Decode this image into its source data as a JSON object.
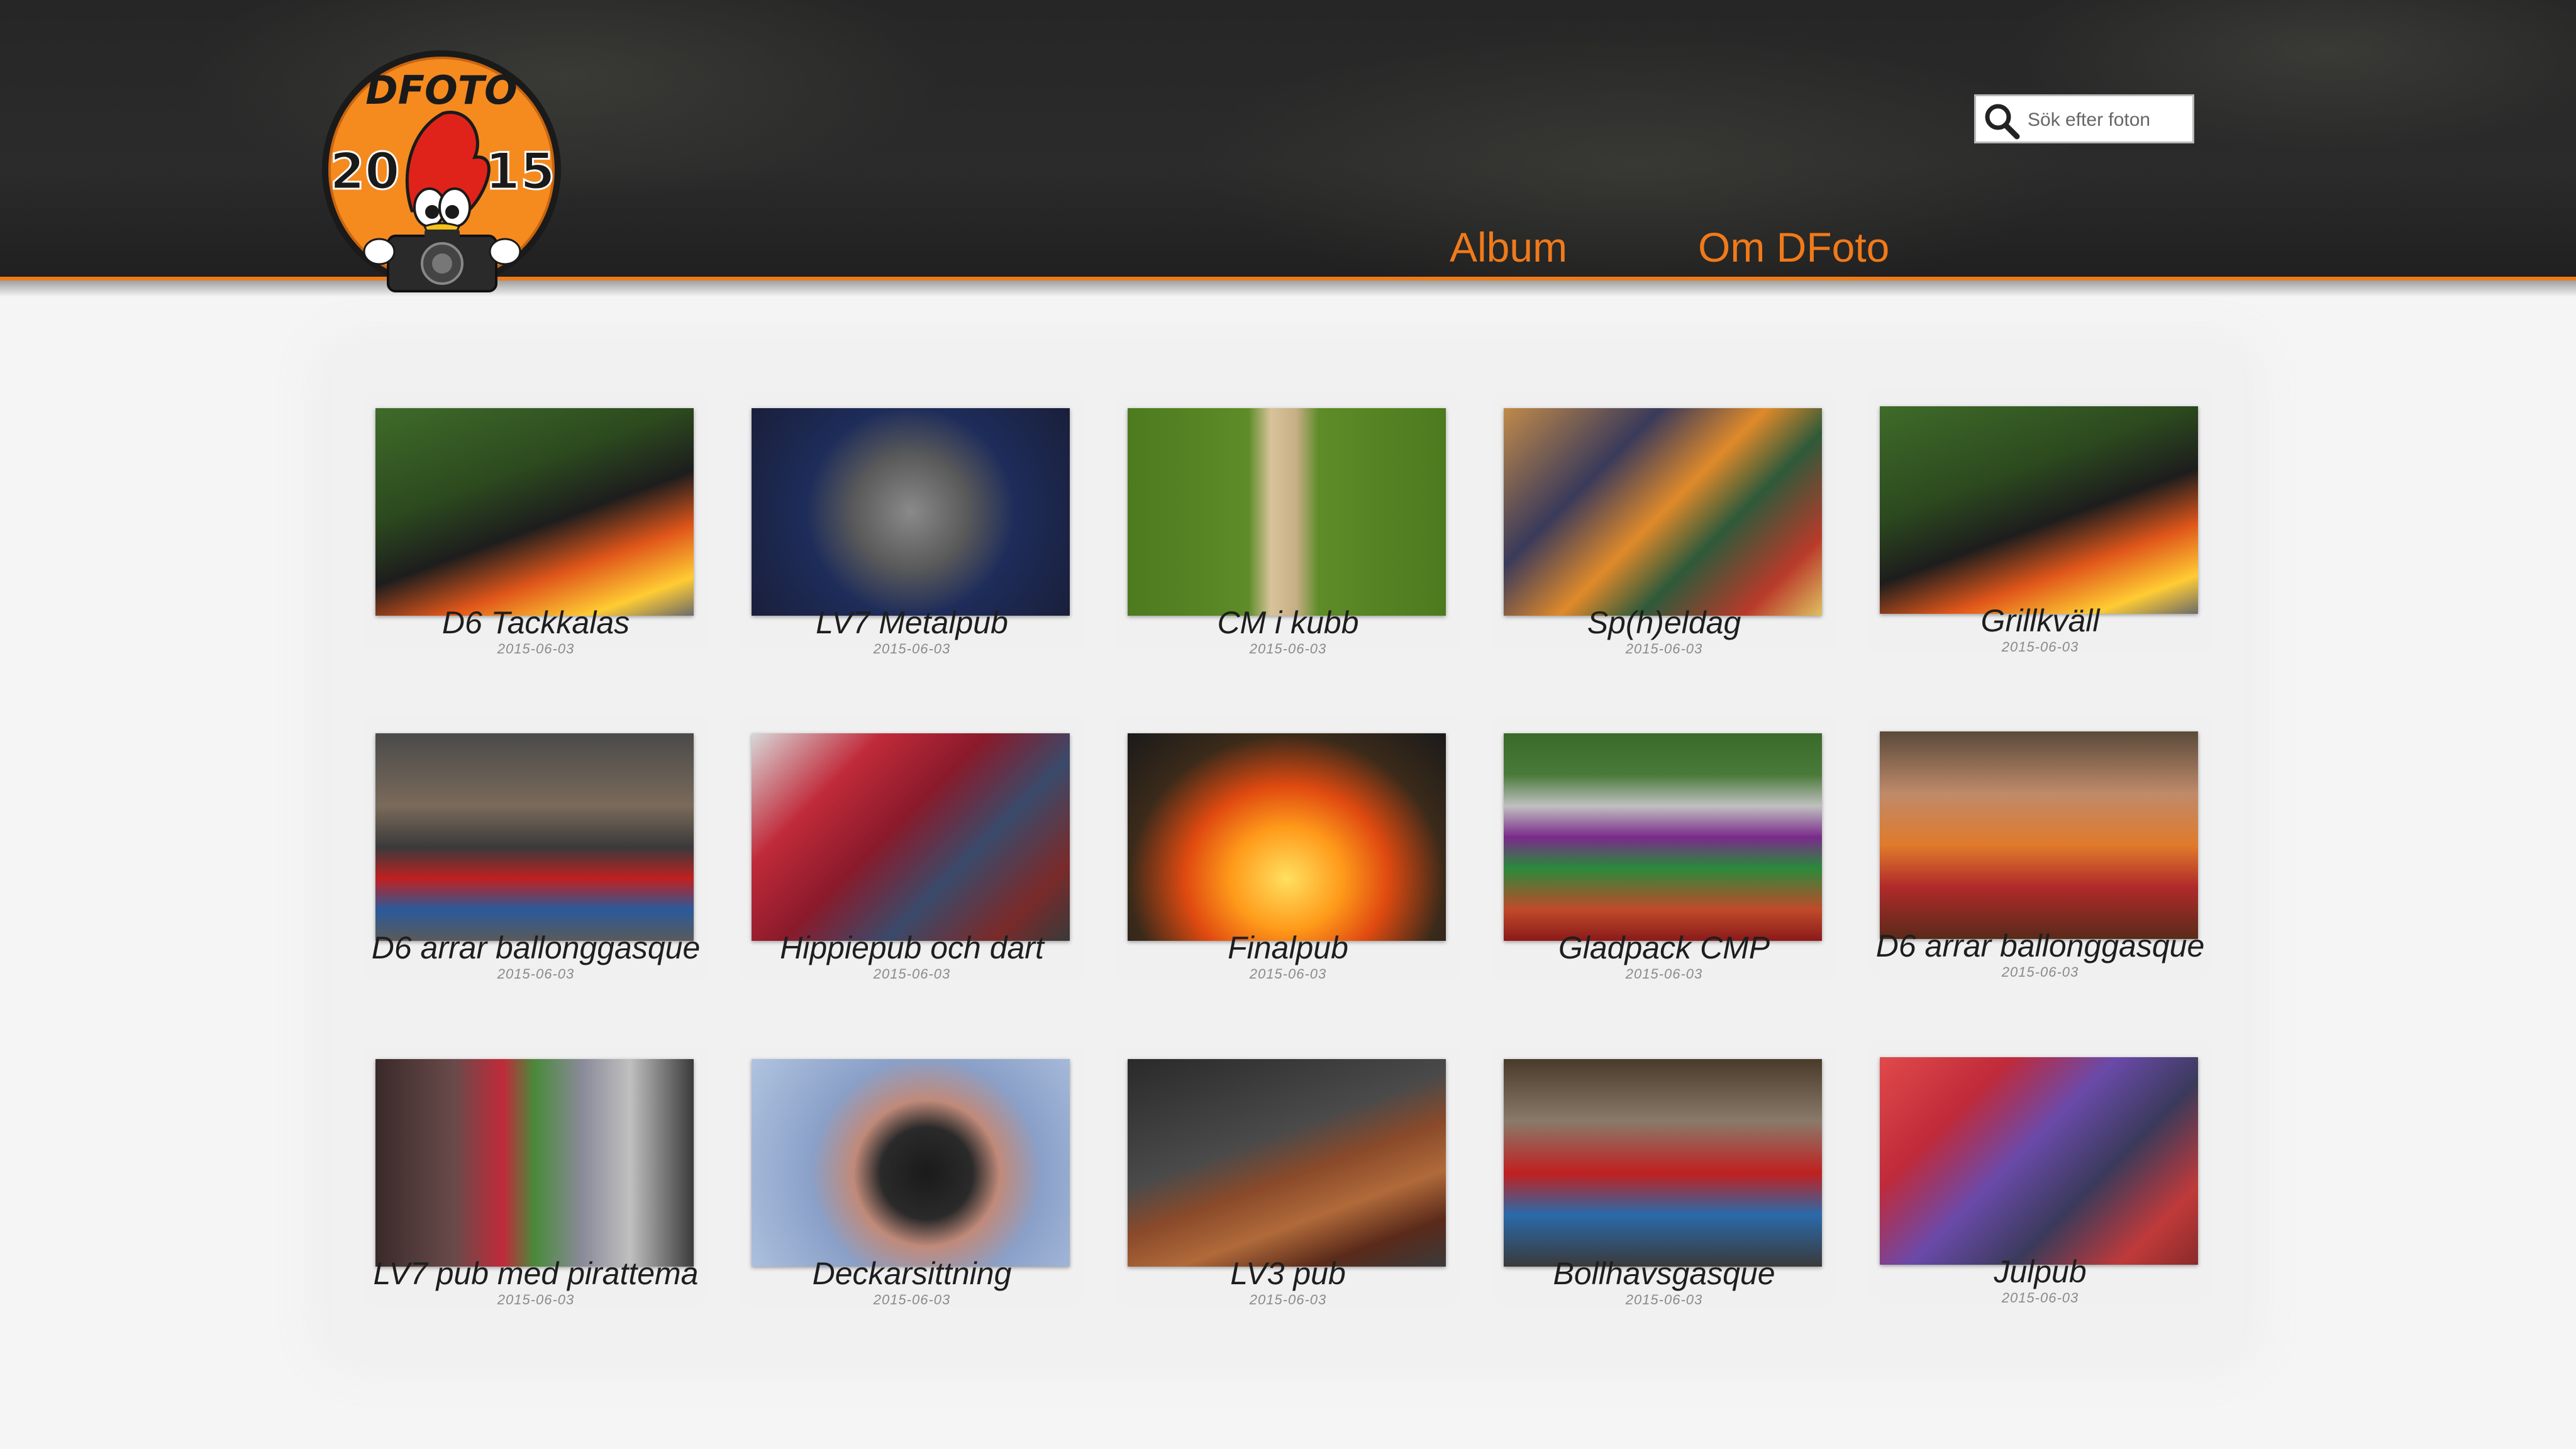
{
  "logo": {
    "text_top": "DFOTO",
    "year_left": "20",
    "year_right": "15"
  },
  "search": {
    "placeholder": "Sök efter foton",
    "icon": "search-icon"
  },
  "nav": [
    {
      "label": "Album"
    },
    {
      "label": "Om DFoto"
    }
  ],
  "colors": {
    "accent": "#f07a1a",
    "header": "#262626",
    "page": "#f5f5f5"
  },
  "albums": [
    {
      "title": "D6 Tackkalas",
      "date": "2015-06-03"
    },
    {
      "title": "LV7 Metalpub",
      "date": "2015-06-03"
    },
    {
      "title": "CM i kubb",
      "date": "2015-06-03"
    },
    {
      "title": "Sp(h)eldag",
      "date": "2015-06-03"
    },
    {
      "title": "Grillkväll",
      "date": "2015-06-03"
    },
    {
      "title": "D6 arrar ballonggasque",
      "date": "2015-06-03"
    },
    {
      "title": "Hippiepub och dart",
      "date": "2015-06-03"
    },
    {
      "title": "Finalpub",
      "date": "2015-06-03"
    },
    {
      "title": "Gladpack CMP",
      "date": "2015-06-03"
    },
    {
      "title": "D6 arrar ballonggasque",
      "date": "2015-06-03"
    },
    {
      "title": "LV7 pub med pirattema",
      "date": "2015-06-03"
    },
    {
      "title": "Deckarsittning",
      "date": "2015-06-03"
    },
    {
      "title": "LV3 pub",
      "date": "2015-06-03"
    },
    {
      "title": "Bollhavsgasque",
      "date": "2015-06-03"
    },
    {
      "title": "Julpub",
      "date": "2015-06-03"
    }
  ]
}
